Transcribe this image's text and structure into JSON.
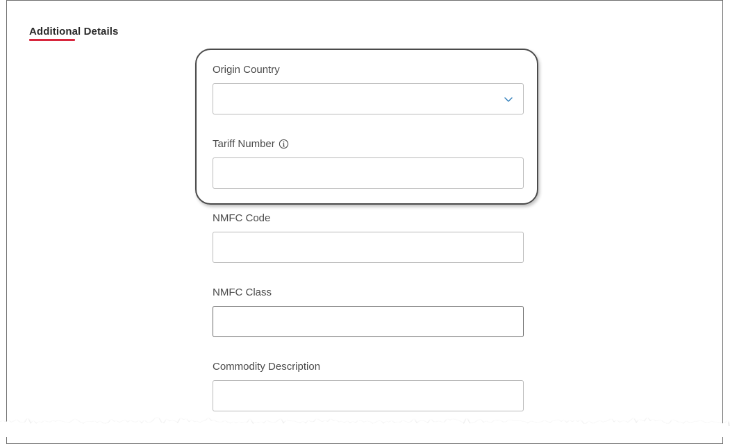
{
  "section": {
    "title": "Additional Details"
  },
  "fields": {
    "origin_country": {
      "label": "Origin Country",
      "value": ""
    },
    "tariff_number": {
      "label": "Tariff Number",
      "value": "",
      "icon": "info-icon"
    },
    "nmfc_code": {
      "label": "NMFC Code",
      "value": ""
    },
    "nmfc_class": {
      "label": "NMFC Class",
      "value": ""
    },
    "commodity_description": {
      "label": "Commodity Description",
      "value": ""
    }
  },
  "colors": {
    "accent_underline": "#d7263d",
    "chevron": "#2b7bb9",
    "highlight_border": "#4a4a4a"
  }
}
